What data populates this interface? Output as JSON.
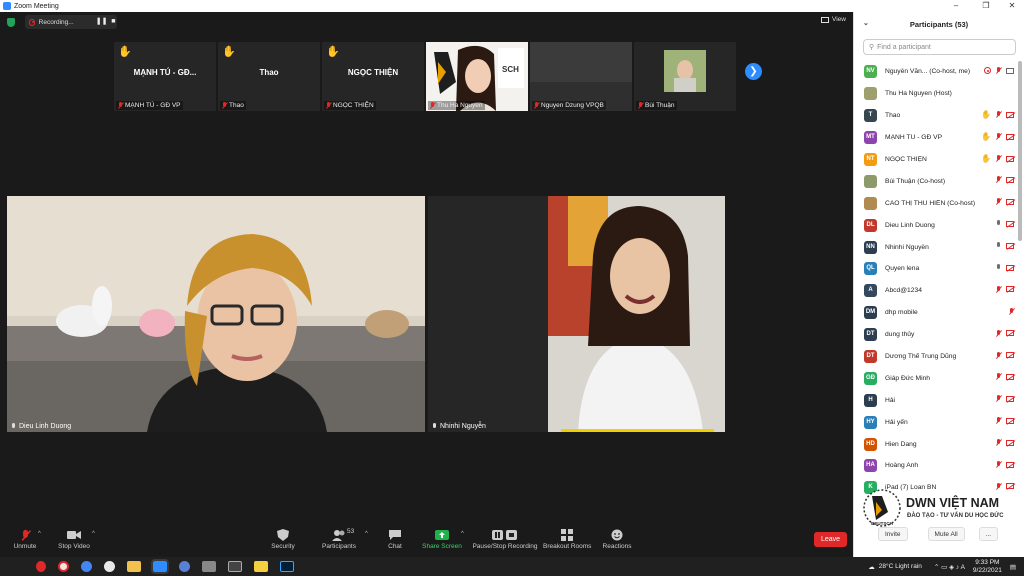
{
  "window": {
    "title": "Zoom Meeting",
    "minimize": "–",
    "restore": "❐",
    "close": "✕"
  },
  "topbar": {
    "recording_label": "Recording...",
    "view_label": "View",
    "pause_glyph": "❚❚",
    "stop_glyph": "■"
  },
  "strip": [
    {
      "name": "MẠNH TÚ - GĐ...",
      "label": "MẠNH TÚ - GĐ VP",
      "hand": true
    },
    {
      "name": "Thao",
      "label": "Thao",
      "hand": true
    },
    {
      "name": "NGỌC THIỆN",
      "label": "NGỌC THIỆN",
      "hand": true
    },
    {
      "name": "",
      "label": "Thu Ha Nguyen",
      "hand": false,
      "video": "person1"
    },
    {
      "name": "",
      "label": "Nguyen Dzung VPQB",
      "hand": false,
      "video": "dark"
    },
    {
      "name": "",
      "label": "Bùi Thuận",
      "hand": false,
      "video": "avatar"
    }
  ],
  "main_video": {
    "left_label": "Dieu Linh Duong",
    "right_label": "Nhinhi Nguyễn"
  },
  "toolbar": {
    "unmute": "Unmute",
    "stop_video": "Stop Video",
    "security": "Security",
    "participants": "Participants",
    "participants_count": "53",
    "chat": "Chat",
    "share_screen": "Share Screen",
    "record": "Pause/Stop Recording",
    "breakout": "Breakout Rooms",
    "reactions": "Reactions",
    "leave": "Leave"
  },
  "panel": {
    "title": "Participants (53)",
    "search_placeholder": "Find a participant",
    "invite": "Invite",
    "mute_all": "Mute All",
    "more": "...",
    "participants": [
      {
        "initials": "NV",
        "name": "Nguyễn Văn... (Co-host, me)",
        "color": "#4caf50",
        "hand": false,
        "mic": "rec",
        "cam": "on"
      },
      {
        "initials": "",
        "name": "Thu Ha Nguyen (Host)",
        "color": "#9e9e6e",
        "hand": false,
        "mic": "none",
        "cam": "none"
      },
      {
        "initials": "T",
        "name": "Thao",
        "color": "#37474f",
        "hand": true,
        "mic": "off",
        "cam": "off"
      },
      {
        "initials": "MT",
        "name": "MẠNH TÚ - GĐ VP",
        "color": "#8e44ad",
        "hand": true,
        "mic": "off",
        "cam": "off"
      },
      {
        "initials": "NT",
        "name": "NGỌC THIỆN",
        "color": "#f39c12",
        "hand": true,
        "mic": "off",
        "cam": "off"
      },
      {
        "initials": "",
        "name": "Bùi Thuận (Co-host)",
        "color": "#8d9b6a",
        "hand": false,
        "mic": "off",
        "cam": "off"
      },
      {
        "initials": "",
        "name": "CAO THỊ THU HIỀN (Co-host)",
        "color": "#b08a50",
        "hand": false,
        "mic": "off",
        "cam": "off"
      },
      {
        "initials": "DL",
        "name": "Dieu Linh Duong",
        "color": "#c0392b",
        "hand": false,
        "mic": "on",
        "cam": "off"
      },
      {
        "initials": "NN",
        "name": "Nhinhi Nguyễn",
        "color": "#2c3e50",
        "hand": false,
        "mic": "on",
        "cam": "off"
      },
      {
        "initials": "QL",
        "name": "Quyen lena",
        "color": "#2980b9",
        "hand": false,
        "mic": "on",
        "cam": "off"
      },
      {
        "initials": "A",
        "name": "Abcd@1234",
        "color": "#34495e",
        "hand": false,
        "mic": "off",
        "cam": "off"
      },
      {
        "initials": "DM",
        "name": "dhp mobile",
        "color": "#2c3e50",
        "hand": false,
        "mic": "off",
        "cam": "none"
      },
      {
        "initials": "DT",
        "name": "dung thủy",
        "color": "#2c3e50",
        "hand": false,
        "mic": "off",
        "cam": "off"
      },
      {
        "initials": "DT",
        "name": "Dương Thế Trung Dũng",
        "color": "#c0392b",
        "hand": false,
        "mic": "off",
        "cam": "off"
      },
      {
        "initials": "GĐ",
        "name": "Giáp Đức Minh",
        "color": "#27ae60",
        "hand": false,
        "mic": "off",
        "cam": "off"
      },
      {
        "initials": "H",
        "name": "Hải",
        "color": "#2c3e50",
        "hand": false,
        "mic": "off",
        "cam": "off"
      },
      {
        "initials": "HY",
        "name": "Hải yến",
        "color": "#2980b9",
        "hand": false,
        "mic": "off",
        "cam": "off"
      },
      {
        "initials": "HD",
        "name": "Hien Dang",
        "color": "#d35400",
        "hand": false,
        "mic": "off",
        "cam": "off"
      },
      {
        "initials": "HA",
        "name": "Hoàng Anh",
        "color": "#8e44ad",
        "hand": false,
        "mic": "off",
        "cam": "off"
      },
      {
        "initials": "K",
        "name": "iPad (7) Loan BN",
        "color": "#27ae60",
        "hand": false,
        "mic": "off",
        "cam": "off"
      }
    ]
  },
  "watermark": {
    "brand": "DWN VIỆT NAM",
    "tagline": "ĐÀO TẠO - TƯ VẤN DU HỌC ĐỨC",
    "logo_text": "DEUTSCH"
  },
  "taskbar": {
    "weather": "28°C  Light rain",
    "time": "9:33 PM",
    "date": "9/22/2021"
  }
}
